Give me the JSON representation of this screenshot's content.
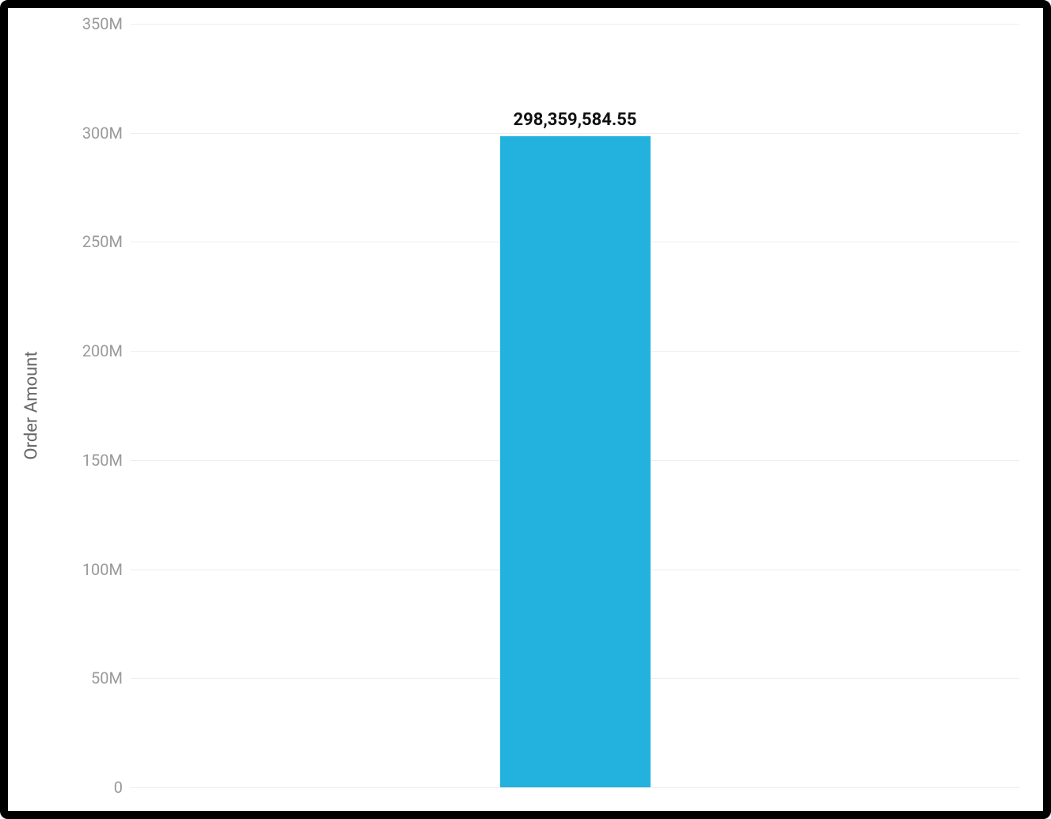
{
  "chart_data": {
    "type": "bar",
    "categories": [
      ""
    ],
    "values": [
      298359584.55
    ],
    "value_labels": [
      "298,359,584.55"
    ],
    "title": "",
    "xlabel": "",
    "ylabel": "Order Amount",
    "ylim": [
      0,
      350000000
    ],
    "y_ticks": [
      0,
      50000000,
      100000000,
      150000000,
      200000000,
      250000000,
      300000000,
      350000000
    ],
    "y_tick_labels": [
      "0",
      "50M",
      "100M",
      "150M",
      "200M",
      "250M",
      "300M",
      "350M"
    ],
    "bar_color": "#23b2dd",
    "grid_color": "#eeeeee"
  }
}
